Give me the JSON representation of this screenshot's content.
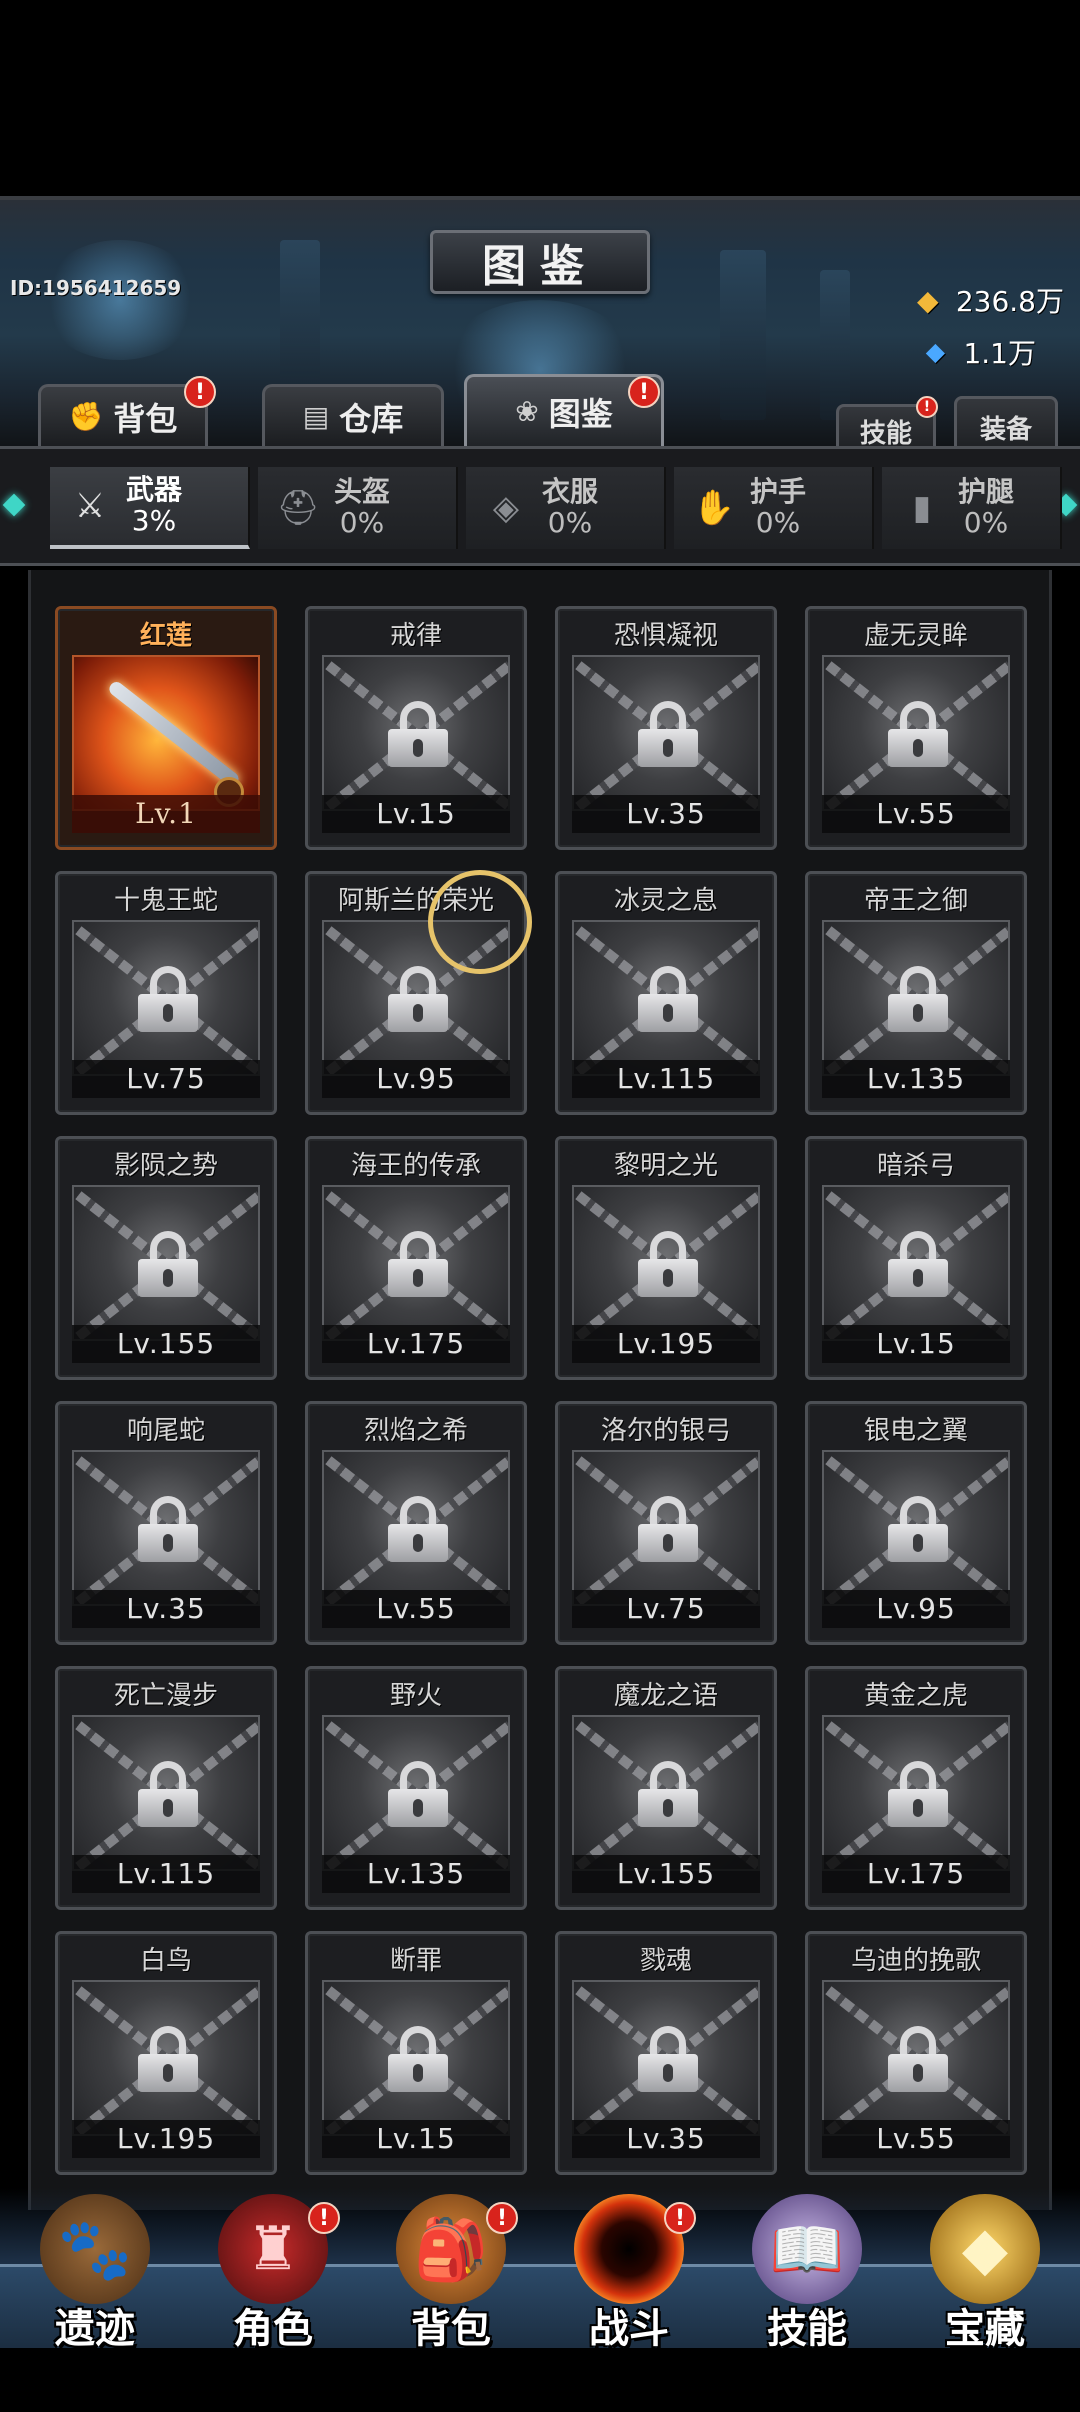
{
  "header": {
    "title": "图鉴",
    "player_id": "ID:1956412659",
    "gold": "236.8万",
    "gems": "1.1万",
    "gold_icon": "gold-ingot-icon",
    "gem_icon": "blue-gem-icon"
  },
  "top_tabs": [
    {
      "label": "背包",
      "icon": "bag-icon",
      "badge": "!"
    },
    {
      "label": "仓库",
      "icon": "storage-icon",
      "badge": ""
    },
    {
      "label": "图鉴",
      "icon": "codex-icon",
      "badge": "!"
    }
  ],
  "side_tabs": [
    {
      "label": "技能",
      "badge": "!"
    },
    {
      "label": "装备",
      "badge": ""
    }
  ],
  "categories": [
    {
      "name": "武器",
      "pct": "3%",
      "icon": "swords-icon"
    },
    {
      "name": "头盔",
      "pct": "0%",
      "icon": "helmet-icon"
    },
    {
      "name": "衣服",
      "pct": "0%",
      "icon": "armor-icon"
    },
    {
      "name": "护手",
      "pct": "0%",
      "icon": "gauntlet-icon"
    },
    {
      "name": "护腿",
      "pct": "0%",
      "icon": "greaves-icon"
    }
  ],
  "items": [
    {
      "name": "红莲",
      "level": "Lv.1",
      "unlocked": true
    },
    {
      "name": "戒律",
      "level": "Lv.15"
    },
    {
      "name": "恐惧凝视",
      "level": "Lv.35"
    },
    {
      "name": "虚无灵眸",
      "level": "Lv.55"
    },
    {
      "name": "十鬼王蛇",
      "level": "Lv.75"
    },
    {
      "name": "阿斯兰的荣光",
      "level": "Lv.95"
    },
    {
      "name": "冰灵之息",
      "level": "Lv.115"
    },
    {
      "name": "帝王之御",
      "level": "Lv.135"
    },
    {
      "name": "影陨之势",
      "level": "Lv.155"
    },
    {
      "name": "海王的传承",
      "level": "Lv.175"
    },
    {
      "name": "黎明之光",
      "level": "Lv.195"
    },
    {
      "name": "暗杀弓",
      "level": "Lv.15"
    },
    {
      "name": "响尾蛇",
      "level": "Lv.35"
    },
    {
      "name": "烈焰之希",
      "level": "Lv.55"
    },
    {
      "name": "洛尔的银弓",
      "level": "Lv.75"
    },
    {
      "name": "银电之翼",
      "level": "Lv.95"
    },
    {
      "name": "死亡漫步",
      "level": "Lv.115"
    },
    {
      "name": "野火",
      "level": "Lv.135"
    },
    {
      "name": "魔龙之语",
      "level": "Lv.155"
    },
    {
      "name": "黄金之虎",
      "level": "Lv.175"
    },
    {
      "name": "白鸟",
      "level": "Lv.195"
    },
    {
      "name": "断罪",
      "level": "Lv.15"
    },
    {
      "name": "戮魂",
      "level": "Lv.35"
    },
    {
      "name": "乌迪的挽歌",
      "level": "Lv.55"
    }
  ],
  "bottom_nav": [
    {
      "label": "遗迹",
      "icon": "paw-relic-icon",
      "badge": ""
    },
    {
      "label": "角色",
      "icon": "hooded-hero-icon",
      "badge": "!"
    },
    {
      "label": "背包",
      "icon": "backpack-icon",
      "badge": "!"
    },
    {
      "label": "战斗",
      "icon": "portal-icon",
      "badge": "!"
    },
    {
      "label": "技能",
      "icon": "spellbook-icon",
      "badge": ""
    },
    {
      "label": "宝藏",
      "icon": "treasure-icon",
      "badge": ""
    }
  ],
  "colors": {
    "accent_orange": "#ffb15a",
    "badge_red": "#d8231c",
    "nav_blue": "#2c4a69"
  }
}
